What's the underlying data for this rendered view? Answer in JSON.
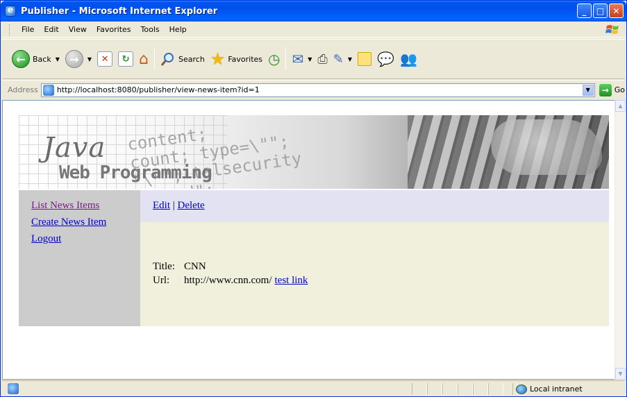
{
  "window": {
    "title": "Publisher - Microsoft Internet Explorer",
    "minimize": "_",
    "maximize": "□",
    "close": "✕"
  },
  "menu": [
    "File",
    "Edit",
    "View",
    "Favorites",
    "Tools",
    "Help"
  ],
  "toolbar": {
    "back_label": "Back",
    "search_label": "Search",
    "favorites_label": "Favorites"
  },
  "address": {
    "label": "Address",
    "url": "http://localhost:8080/publisher/view-news-item?id=1",
    "go_label": "Go"
  },
  "banner": {
    "line1": "Java",
    "line2": "Web Programming",
    "code_text": "content;\ncount; type=\\\"\";\n\"\\\"\"; talsecurity\nlocked\";\n    {"
  },
  "sidebar": {
    "links": [
      "List News Items",
      "Create News Item",
      "Logout"
    ]
  },
  "actions": {
    "edit": "Edit",
    "separator": "|",
    "delete": "Delete"
  },
  "news_item": {
    "title_label": "Title:",
    "title_value": "CNN",
    "url_label": "Url:",
    "url_value": "http://www.cnn.com/",
    "test_link": "test link"
  },
  "status": {
    "zone": "Local intranet"
  },
  "colors": {
    "sidebar_bg": "#cccccc",
    "topbar_bg": "#e2e2f2",
    "content_bg": "#f0f0dc",
    "link": "#0000cc",
    "visited_link": "#7b1a8a"
  }
}
